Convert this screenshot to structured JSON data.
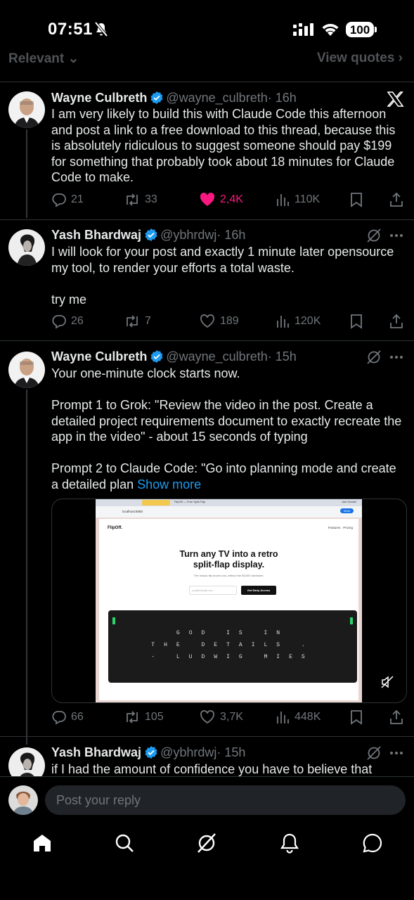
{
  "status_bar": {
    "time": "07:51",
    "battery": "100"
  },
  "filter": {
    "sort_label": "Relevant",
    "quotes_label": "View quotes"
  },
  "tweets": [
    {
      "name": "Wayne Culbreth",
      "handle": "@wayne_culbreth",
      "time": "· 16h",
      "text": "I am very likely to build this with Claude Code this afternoon and post a link to a free download to this thread, because this is absolutely ridiculous to suggest someone should pay $199 for something that probably took about 18 minutes for Claude Code to make.",
      "replies": "21",
      "reposts": "33",
      "likes": "2,4K",
      "views": "110K"
    },
    {
      "name": "Yash Bhardwaj",
      "handle": "@ybhrdwj",
      "time": "· 16h",
      "text": "I will look for your post and exactly 1 minute later opensource my tool, to render your efforts a total waste.\n\ntry me",
      "replies": "26",
      "reposts": "7",
      "likes": "189",
      "views": "120K"
    },
    {
      "name": "Wayne Culbreth",
      "handle": "@wayne_culbreth",
      "time": "· 15h",
      "text": "Your one-minute clock starts now.\n\nPrompt 1 to Grok: \"Review the video in the post. Create a detailed project requirements document to exactly recreate the app in the video\" - about 15 seconds of typing\n\nPrompt 2 to Claude Code: \"Go into planning mode and create a detailed plan ",
      "show_more": "Show more",
      "replies": "66",
      "reposts": "105",
      "likes": "3,7K",
      "views": "448K"
    },
    {
      "name": "Yash Bhardwaj",
      "handle": "@ybhrdwj",
      "time": "· 15h",
      "text": "if I had the amount of confidence you have to believe that"
    }
  ],
  "media": {
    "url": "localhost:8080",
    "tab_title": "FlipOff — Free Split-Flap",
    "ask_gemini": "Ask Gemini",
    "work": "Work",
    "logo": "FlipOff.",
    "nav": [
      "Features",
      "Pricing"
    ],
    "headline": "Turn any TV into a retro split-flap display.",
    "subline": "The classic flip-board look, without the $3,500 hardware.",
    "email_placeholder": "you@example.com",
    "cta": "Get Early Access",
    "board_lines": [
      "GOD IS IN",
      "THE DETAILS .",
      "- LUDWIG MIES"
    ]
  },
  "reply_bar": {
    "placeholder": "Post your reply"
  },
  "tabs": [
    "home",
    "search",
    "grok",
    "notifications",
    "messages"
  ]
}
